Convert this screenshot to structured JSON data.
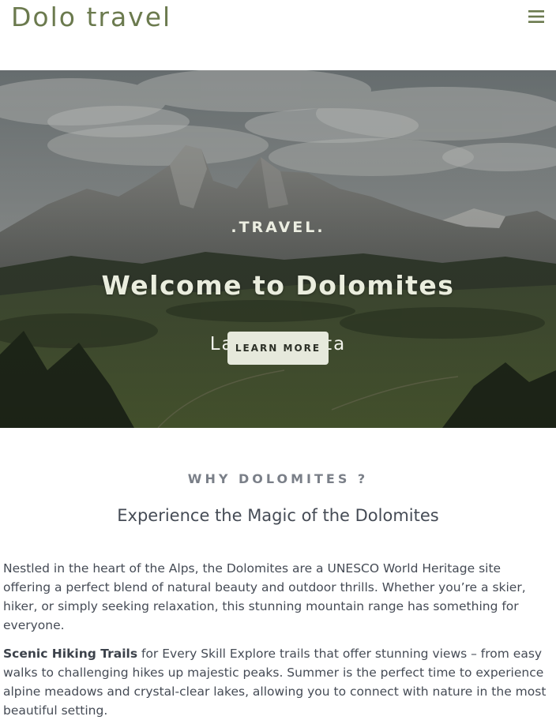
{
  "header": {
    "brand": "Dolo travel",
    "menu_icon": "hamburger-menu-icon"
  },
  "hero": {
    "background": "dolomites-mountain-landscape",
    "kicker": ".TRAVEL.",
    "title": "Welcome to Dolomites",
    "subtitle": "La dolce vita",
    "cta_label": "LEARN MORE"
  },
  "why": {
    "eyebrow": "WHY DOLOMITES ?",
    "title": "Experience the Magic of the Dolomites",
    "intro": "Nestled in the heart of the Alps, the Dolomites are a UNESCO World Heritage site offering a perfect blend of natural beauty and outdoor thrills. Whether you’re a skier, hiker, or simply seeking relaxation, this stunning mountain range has something for everyone.",
    "feature_title": "Scenic Hiking Trails",
    "feature_text": " for Every Skill Explore trails that offer stunning views – from easy walks to challenging hikes up majestic peaks. Summer is the perfect time to experience alpine meadows and crystal-clear lakes, allowing you to connect with nature in the most beautiful setting."
  },
  "colors": {
    "brand": "#6b7a4e",
    "text": "#454b55",
    "eyebrow": "#7a7f88",
    "button_bg": "#e6e9dc"
  }
}
